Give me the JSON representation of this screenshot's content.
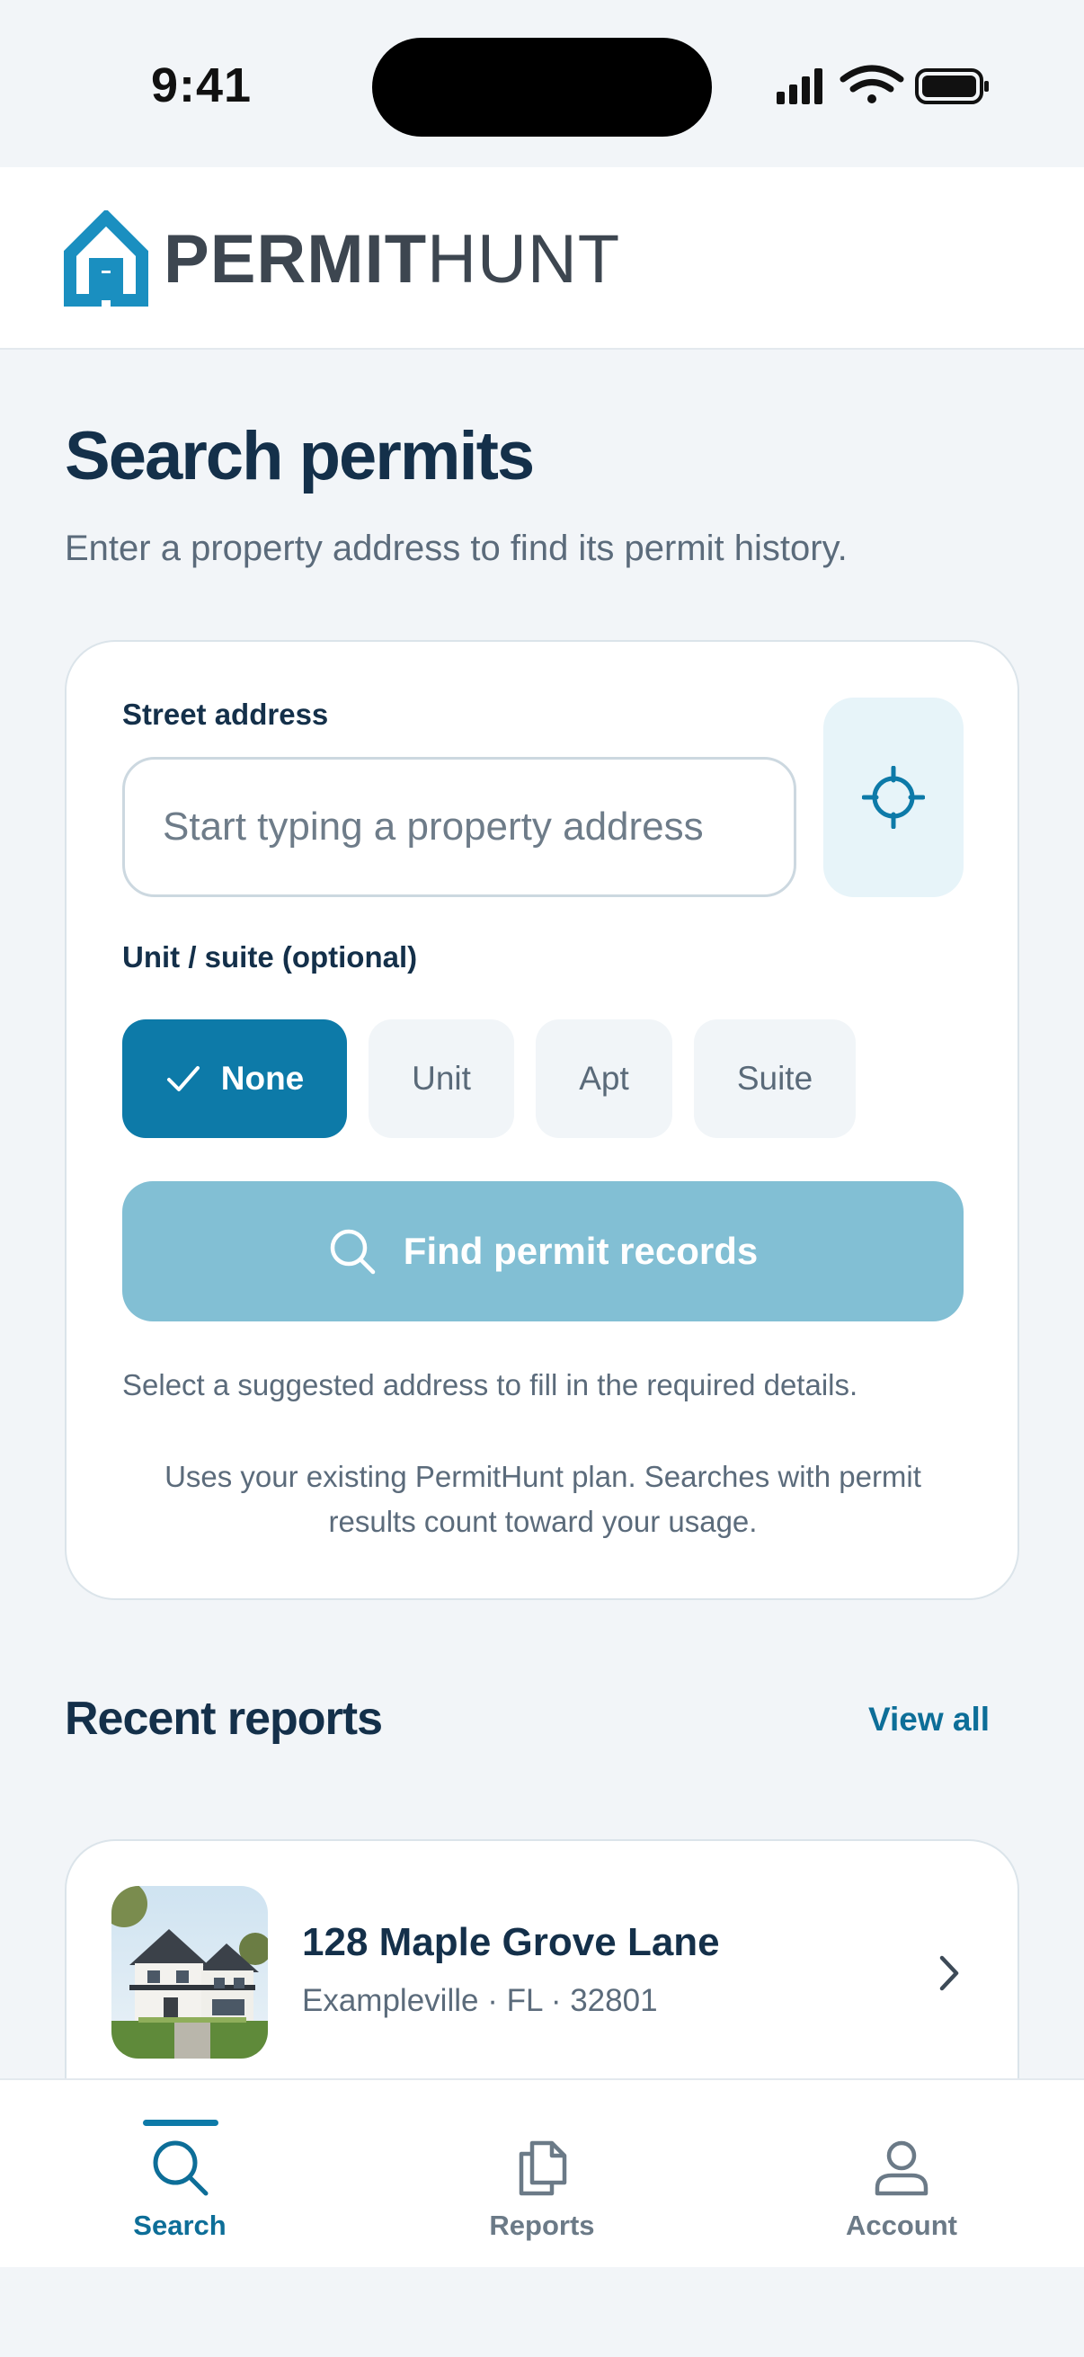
{
  "status_bar": {
    "time": "9:41"
  },
  "header": {
    "logo_bold": "PERMIT",
    "logo_light": "HUNT"
  },
  "page": {
    "title": "Search permits",
    "subtitle": "Enter a property address to find its permit history."
  },
  "search": {
    "address_label": "Street address",
    "address_placeholder": "Start typing a property address",
    "address_value": "",
    "unit_label": "Unit / suite (optional)",
    "unit_options": [
      {
        "label": "None",
        "selected": true
      },
      {
        "label": "Unit",
        "selected": false
      },
      {
        "label": "Apt",
        "selected": false
      },
      {
        "label": "Suite",
        "selected": false
      }
    ],
    "find_button": "Find permit records",
    "hint": "Select a suggested address to fill in the required details.",
    "plan_note": "Uses your existing PermitHunt plan. Searches with permit results count toward your usage."
  },
  "recent": {
    "title": "Recent reports",
    "view_all": "View all",
    "items": [
      {
        "address": "128 Maple Grove Lane",
        "meta": "Exampleville · FL · 32801",
        "thumbnail": "house-photo"
      }
    ]
  },
  "tabs": [
    {
      "label": "Search",
      "icon": "search-icon",
      "active": true
    },
    {
      "label": "Reports",
      "icon": "documents-icon",
      "active": false
    },
    {
      "label": "Account",
      "icon": "person-icon",
      "active": false
    }
  ],
  "colors": {
    "accent": "#0d7aa8",
    "accent_dark": "#0d6e98",
    "button_disabled": "#82bfd4",
    "text_primary": "#14304a",
    "text_secondary": "#5b6b7b",
    "background": "#f2f5f8"
  }
}
